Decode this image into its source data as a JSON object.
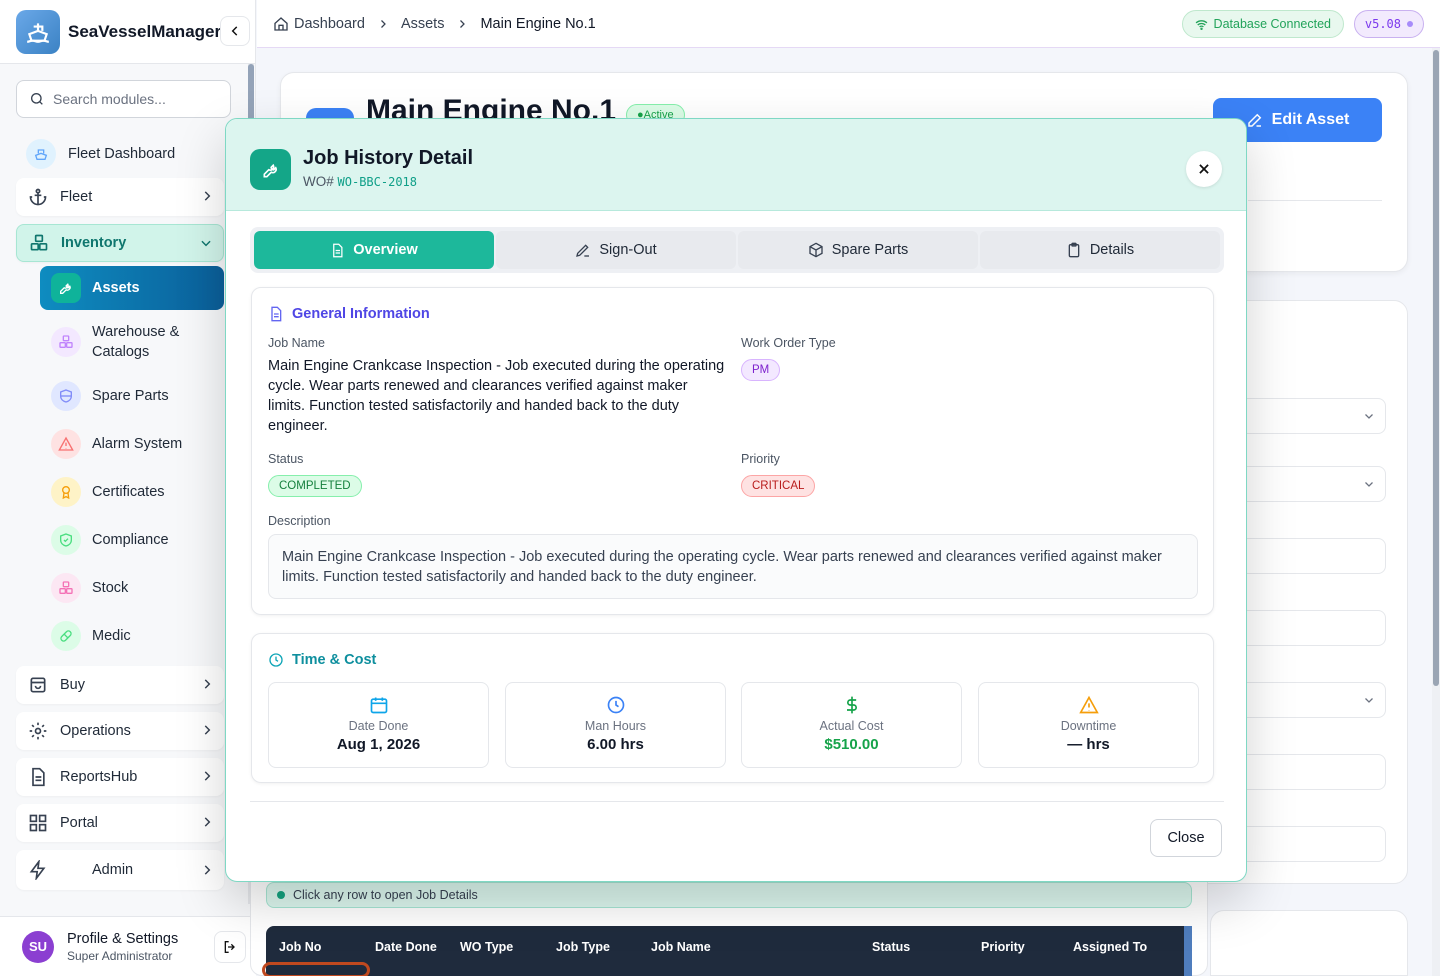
{
  "app": {
    "name": "SeaVesselManager"
  },
  "search": {
    "placeholder": "Search modules..."
  },
  "sidebar": {
    "fleet_dashboard": "Fleet Dashboard",
    "fleet": "Fleet",
    "inventory": "Inventory",
    "inventory_children": [
      "Assets",
      "Warehouse & Catalogs",
      "Spare Parts",
      "Alarm System",
      "Certificates",
      "Compliance",
      "Stock",
      "Medic"
    ],
    "buy": "Buy",
    "operations": "Operations",
    "reportshub": "ReportsHub",
    "portal": "Portal",
    "admin": "Admin"
  },
  "profile": {
    "initials": "SU",
    "name": "Profile & Settings",
    "role": "Super Administrator"
  },
  "breadcrumb": [
    "Dashboard",
    "Assets",
    "Main Engine No.1"
  ],
  "status": {
    "db": "Database Connected",
    "version": "v5.08"
  },
  "asset": {
    "title": "Main Engine No.1",
    "state": "Active",
    "edit_label": "Edit Asset"
  },
  "table": {
    "hint": "Click any row to open Job Details",
    "headers": [
      "Job No",
      "Date Done",
      "WO Type",
      "Job Type",
      "Job Name",
      "Status",
      "Priority",
      "Assigned To"
    ]
  },
  "modal": {
    "title": "Job History Detail",
    "wo_prefix": "WO#",
    "wo_number": "WO-BBC-2018",
    "tabs": [
      "Overview",
      "Sign-Out",
      "Spare Parts",
      "Details"
    ],
    "general": {
      "title": "General Information",
      "job_name_label": "Job Name",
      "job_name": "Main Engine Crankcase Inspection - Job executed during the operating cycle. Wear parts renewed and clearances verified against maker limits. Function tested satisfactorily and handed back to the duty engineer.",
      "wo_type_label": "Work Order Type",
      "wo_type": "PM",
      "status_label": "Status",
      "status": "COMPLETED",
      "priority_label": "Priority",
      "priority": "CRITICAL",
      "description_label": "Description",
      "description": "Main Engine Crankcase Inspection - Job executed during the operating cycle. Wear parts renewed and clearances verified against maker limits. Function tested satisfactorily and handed back to the duty engineer."
    },
    "time_cost": {
      "title": "Time & Cost",
      "date_done_label": "Date Done",
      "date_done": "Aug 1, 2026",
      "man_hours_label": "Man Hours",
      "man_hours": "6.00 hrs",
      "actual_cost_label": "Actual Cost",
      "actual_cost": "$510.00",
      "downtime_label": "Downtime",
      "downtime": "— hrs"
    },
    "close_label": "Close"
  },
  "colors": {
    "accent": "#1db89b",
    "primary": "#3b82f6",
    "sidebar_active": "#0b5f9a"
  }
}
